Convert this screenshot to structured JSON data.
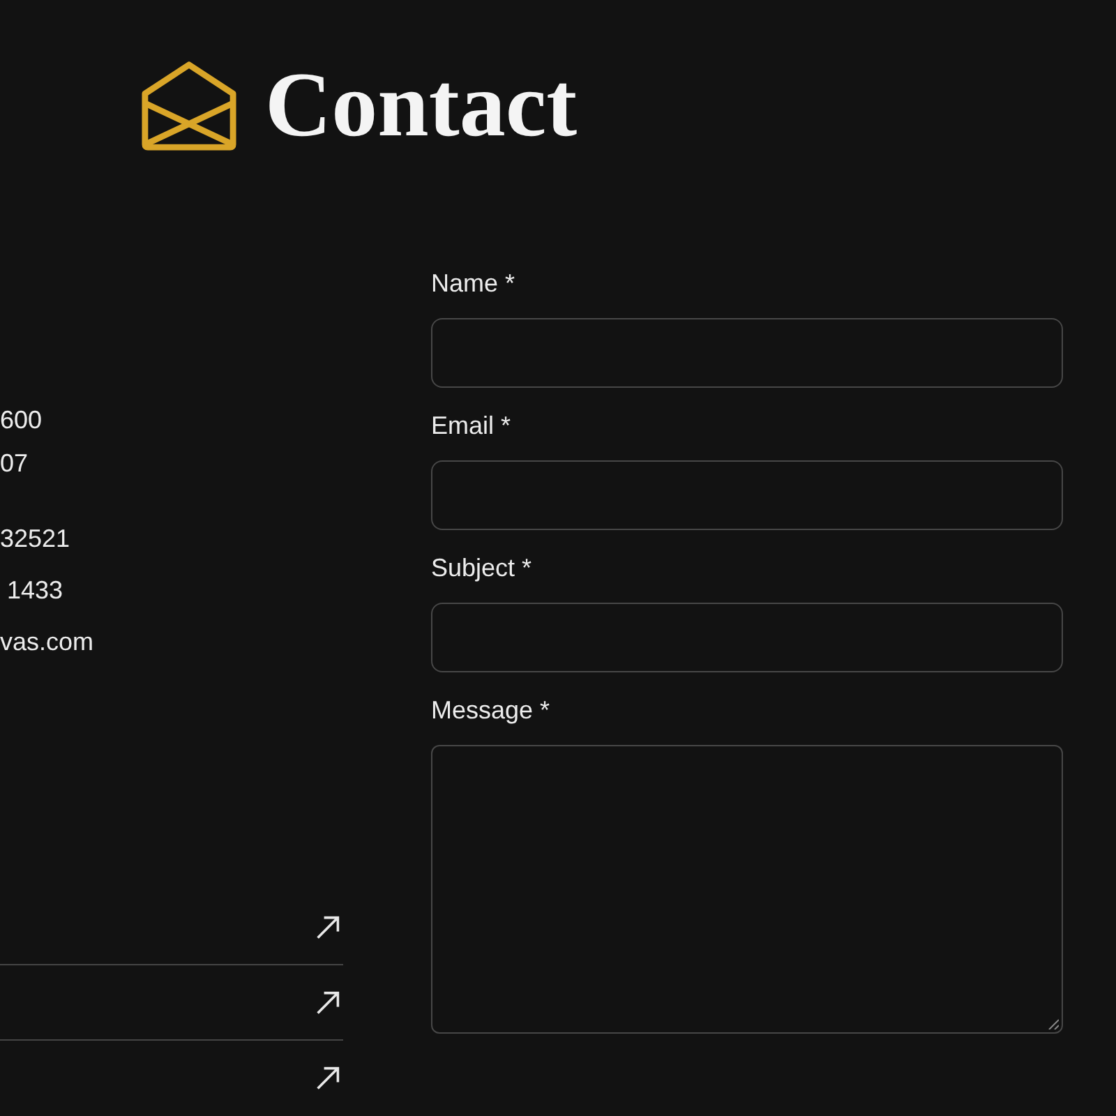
{
  "header": {
    "title": "Contact"
  },
  "contact_groups": [
    {
      "lines": [
        "600",
        "07"
      ]
    },
    {
      "lines": [
        "32521",
        " 1433",
        "vas.com"
      ]
    }
  ],
  "links": [
    {
      "kind": "external"
    },
    {
      "kind": "external"
    },
    {
      "kind": "external"
    }
  ],
  "form": {
    "fields": [
      {
        "label": "Name *",
        "kind": "input"
      },
      {
        "label": "Email *",
        "kind": "input"
      },
      {
        "label": "Subject *",
        "kind": "input"
      },
      {
        "label": "Message *",
        "kind": "textarea"
      }
    ]
  }
}
